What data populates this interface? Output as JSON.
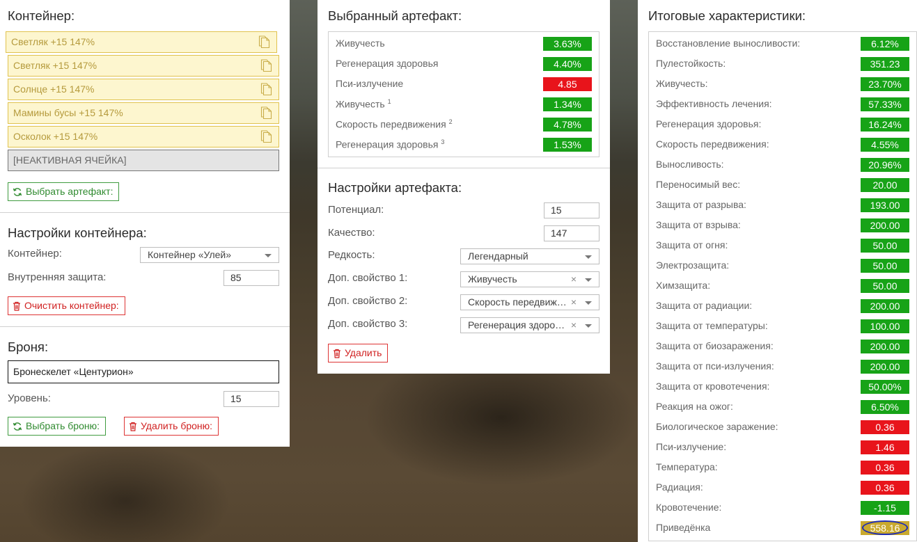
{
  "container": {
    "title": "Контейнер:",
    "slots": [
      {
        "label": "Светляк +15 147%"
      },
      {
        "label": "Светляк +15 147%"
      },
      {
        "label": "Солнце +15 147%"
      },
      {
        "label": "Мамины бусы +15 147%"
      },
      {
        "label": "Осколок +15 147%"
      }
    ],
    "inactive_slot": "[НЕАКТИВНАЯ ЯЧЕЙКА]",
    "select_artifact_button": "Выбрать артефакт:"
  },
  "container_settings": {
    "title": "Настройки контейнера:",
    "container_label": "Контейнер:",
    "container_value": "Контейнер «Улей»",
    "protection_label": "Внутренняя защита:",
    "protection_value": "85",
    "clear_button": "Очистить контейнер:"
  },
  "armor": {
    "title": "Броня:",
    "name": "Бронескелет «Центурион»",
    "level_label": "Уровень:",
    "level_value": "15",
    "select_button": "Выбрать броню:",
    "delete_button": "Удалить броню:"
  },
  "selected_artifact": {
    "title": "Выбранный артефакт:",
    "stats": [
      {
        "name": "Живучесть",
        "sup": "",
        "value": "3.63%",
        "status": "pos"
      },
      {
        "name": "Регенерация здоровья",
        "sup": "",
        "value": "4.40%",
        "status": "pos"
      },
      {
        "name": "Пси-излучение",
        "sup": "",
        "value": "4.85",
        "status": "neg"
      },
      {
        "name": "Живучесть",
        "sup": "1",
        "value": "1.34%",
        "status": "pos"
      },
      {
        "name": "Скорость передвижения",
        "sup": "2",
        "value": "4.78%",
        "status": "pos"
      },
      {
        "name": "Регенерация здоровья",
        "sup": "3",
        "value": "1.53%",
        "status": "pos"
      }
    ]
  },
  "artifact_settings": {
    "title": "Настройки артефакта:",
    "potential_label": "Потенциал:",
    "potential_value": "15",
    "quality_label": "Качество:",
    "quality_value": "147",
    "rarity_label": "Редкость:",
    "rarity_value": "Легендарный",
    "extra1_label": "Доп. свойство 1:",
    "extra1_value": "Живучесть",
    "extra2_label": "Доп. свойство 2:",
    "extra2_value": "Скорость передвижения",
    "extra3_label": "Доп. свойство 3:",
    "extra3_value": "Регенерация здоровья",
    "clear_symbol": "×",
    "delete_button": "Удалить"
  },
  "totals": {
    "title": "Итоговые характеристики:",
    "stats": [
      {
        "name": "Восстановление выносливости:",
        "value": "6.12%",
        "status": "pos"
      },
      {
        "name": "Пулестойкость:",
        "value": "351.23",
        "status": "pos"
      },
      {
        "name": "Живучесть:",
        "value": "23.70%",
        "status": "pos"
      },
      {
        "name": "Эффективность лечения:",
        "value": "57.33%",
        "status": "pos"
      },
      {
        "name": "Регенерация здоровья:",
        "value": "16.24%",
        "status": "pos"
      },
      {
        "name": "Скорость передвижения:",
        "value": "4.55%",
        "status": "pos"
      },
      {
        "name": "Выносливость:",
        "value": "20.96%",
        "status": "pos"
      },
      {
        "name": "Переносимый вес:",
        "value": "20.00",
        "status": "pos"
      },
      {
        "name": "Защита от разрыва:",
        "value": "193.00",
        "status": "pos"
      },
      {
        "name": "Защита от взрыва:",
        "value": "200.00",
        "status": "pos"
      },
      {
        "name": "Защита от огня:",
        "value": "50.00",
        "status": "pos"
      },
      {
        "name": "Электрозащита:",
        "value": "50.00",
        "status": "pos"
      },
      {
        "name": "Химзащита:",
        "value": "50.00",
        "status": "pos"
      },
      {
        "name": "Защита от радиации:",
        "value": "200.00",
        "status": "pos"
      },
      {
        "name": "Защита от температуры:",
        "value": "100.00",
        "status": "pos"
      },
      {
        "name": "Защита от биозаражения:",
        "value": "200.00",
        "status": "pos"
      },
      {
        "name": "Защита от пси-излучения:",
        "value": "200.00",
        "status": "pos"
      },
      {
        "name": "Защита от кровотечения:",
        "value": "50.00%",
        "status": "pos"
      },
      {
        "name": "Реакция на ожог:",
        "value": "6.50%",
        "status": "pos"
      },
      {
        "name": "Биологическое заражение:",
        "value": "0.36",
        "status": "neg"
      },
      {
        "name": "Пси-излучение:",
        "value": "1.46",
        "status": "neg"
      },
      {
        "name": "Температура:",
        "value": "0.36",
        "status": "neg"
      },
      {
        "name": "Радиация:",
        "value": "0.36",
        "status": "neg"
      },
      {
        "name": "Кровотечение:",
        "value": "-1.15",
        "status": "pos"
      },
      {
        "name": "Приведёнка",
        "value": "558.16",
        "status": "gold"
      }
    ]
  },
  "colors": {
    "positive": "#17a317",
    "negative": "#e8141b",
    "highlight": "#c9a92e",
    "slot_fill": "#fdf6cf",
    "slot_border": "#e0c24e"
  }
}
